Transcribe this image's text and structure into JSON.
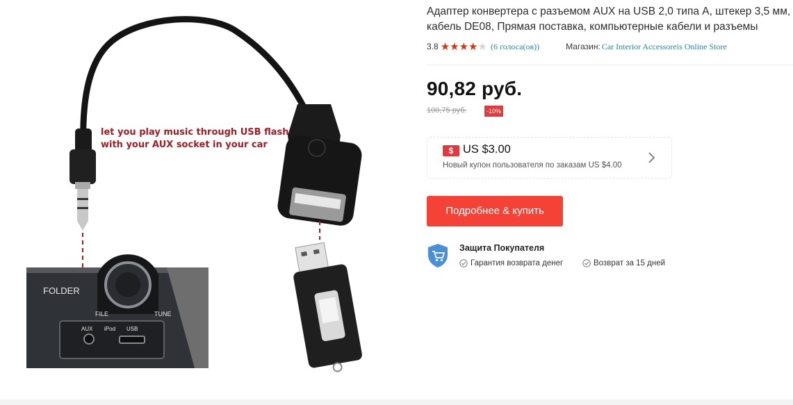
{
  "product": {
    "image_caption_line1": "let you play music through USB flash",
    "image_caption_line2": "with your AUX socket in your car",
    "image_panel_labels": {
      "folder": "FOLDER",
      "file": "FILE",
      "tune": "TUNE",
      "aux": "AUX",
      "ipod": "iPod",
      "usb": "USB"
    },
    "title": "Адаптер конвертера с разъемом AUX на USB 2,0 типа A, штекер 3,5 мм, кабель DE08, Прямая поставка, компьютерные кабели и разъемы",
    "rating": {
      "value": "3.8",
      "stars_filled": 4,
      "stars_total": 5,
      "votes_text": "(6 голоса(ов))"
    },
    "store": {
      "label": "Магазин:",
      "name": "Car Interior Accessoreis Online Store"
    },
    "price": {
      "current": "90,82 руб.",
      "old": "100,75 руб.",
      "discount": "-10%"
    },
    "coupon": {
      "icon": "dollar-coupon-icon",
      "amount": "US $3.00",
      "description": "Новый купон пользователя по заказам US $4.00"
    },
    "buy_button_label": "Подробнее & купить",
    "protection": {
      "title": "Защита Покупателя",
      "items": [
        "Гарантия возврата денег",
        "Возврат за 15 дней"
      ]
    }
  },
  "colors": {
    "accent_red": "#f44336",
    "badge_red": "#e4393c",
    "star_red": "#e62e04",
    "link_blue": "#2e7fb8",
    "shield_blue": "#4a90d9"
  }
}
